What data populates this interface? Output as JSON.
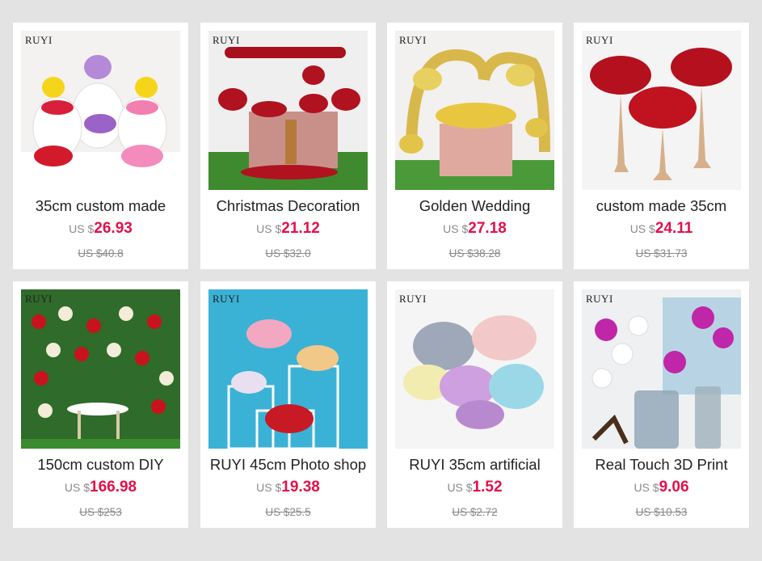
{
  "brand_label": "RUYI",
  "colors": {
    "background": "#e3e3e3",
    "card": "#ffffff",
    "price": "#e3104a",
    "muted": "#8a8a8a"
  },
  "products": [
    {
      "title": "35cm custom made",
      "currency": "US $",
      "price": "26.93",
      "original_price": "US $40.8",
      "image": "flower-unicorn-figures-image"
    },
    {
      "title": "Christmas Decoration",
      "currency": "US $",
      "price": "21.12",
      "original_price": "US $32.0",
      "image": "red-rose-table-arch-image"
    },
    {
      "title": "Golden Wedding",
      "currency": "US $",
      "price": "27.18",
      "original_price": "US $38.28",
      "image": "golden-wedding-arch-image"
    },
    {
      "title": "custom made 35cm",
      "currency": "US $",
      "price": "24.11",
      "original_price": "US $31.73",
      "image": "red-rose-ball-stands-image"
    },
    {
      "title": "150cm custom DIY",
      "currency": "US $",
      "price": "166.98",
      "original_price": "US $253",
      "image": "rose-flower-wall-image"
    },
    {
      "title": "RUYI 45cm Photo shop",
      "currency": "US $",
      "price": "19.38",
      "original_price": "US $25.5",
      "image": "flower-pillar-display-image"
    },
    {
      "title": "RUYI 35cm artificial",
      "currency": "US $",
      "price": "1.52",
      "original_price": "US $2.72",
      "image": "pastel-artificial-plants-image"
    },
    {
      "title": "Real Touch 3D Print",
      "currency": "US $",
      "price": "9.06",
      "original_price": "US $10.53",
      "image": "orchid-vase-image"
    }
  ]
}
